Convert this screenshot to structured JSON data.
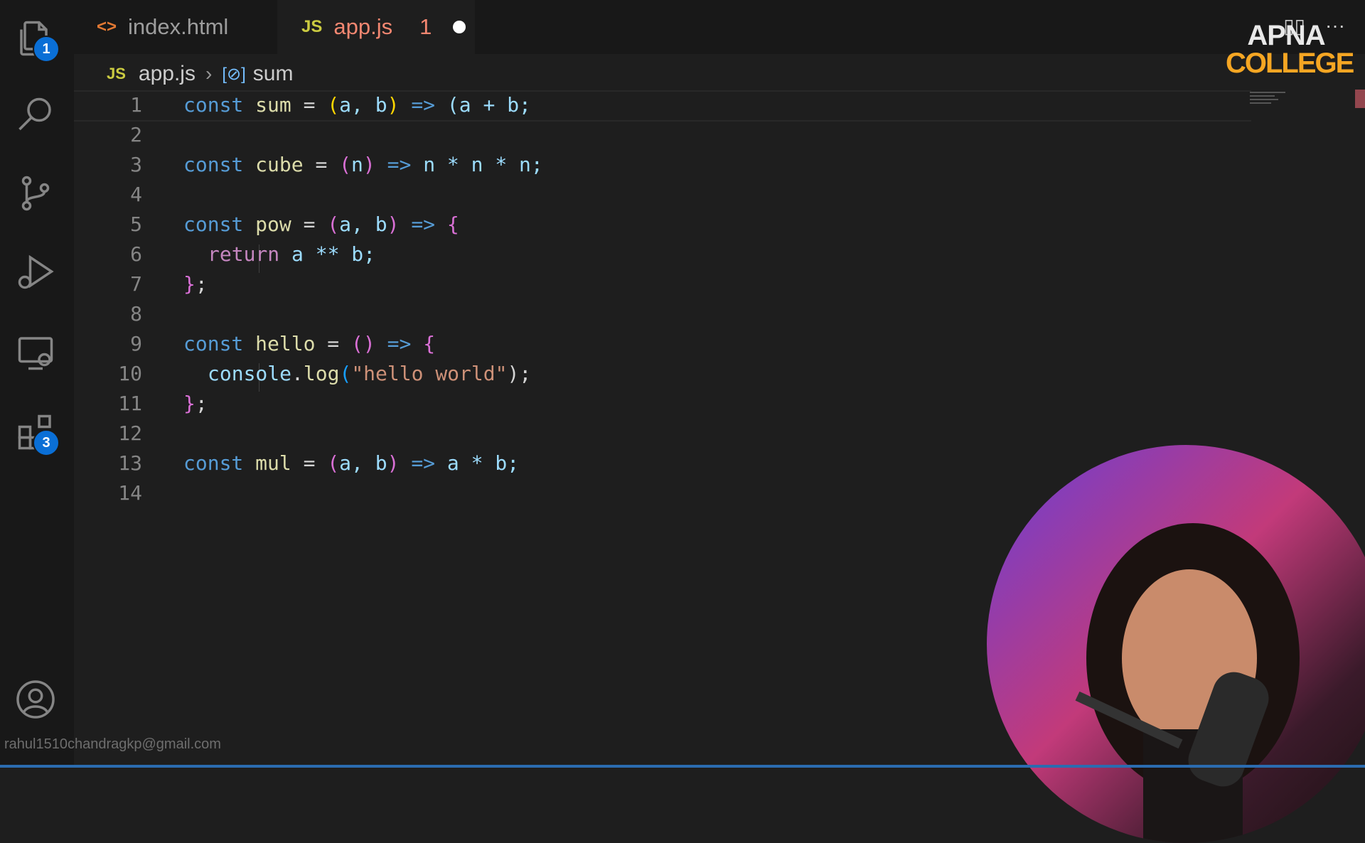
{
  "tabs": [
    {
      "label": "index.html",
      "icon": "html-file-icon",
      "color": "#cccccc"
    },
    {
      "label": "app.js",
      "icon": "js-file-icon",
      "color": "#f48771",
      "problems": "1",
      "modified": true
    }
  ],
  "breadcrumb": {
    "file_type": "JS",
    "file": "app.js",
    "symbol": "sum"
  },
  "activity_bar": {
    "explorer_badge": "1",
    "extensions_badge": "3"
  },
  "editor": {
    "line_numbers": [
      "1",
      "2",
      "3",
      "4",
      "5",
      "6",
      "7",
      "8",
      "9",
      "10",
      "11",
      "12",
      "13",
      "14"
    ],
    "code": {
      "l1": {
        "kw": "const",
        "name": "sum",
        "eq": " = ",
        "params": "a, b",
        "arrow": "=>",
        "body": "(a + b;"
      },
      "l3": {
        "kw": "const",
        "name": "cube",
        "eq": " = ",
        "params": "n",
        "arrow": "=>",
        "body": "n * n * n;"
      },
      "l5": {
        "kw": "const",
        "name": "pow",
        "eq": " = ",
        "params": "a, b",
        "arrow": "=>",
        "open": "{"
      },
      "l6": {
        "ret": "return",
        "body": "a ** b;"
      },
      "l7": {
        "close": "}",
        "semi": ";"
      },
      "l9": {
        "kw": "const",
        "name": "hello",
        "eq": " = ",
        "params": "",
        "arrow": "=>",
        "open": "{"
      },
      "l10": {
        "obj": "console",
        "method": "log",
        "str": "\"hello world\"",
        "end": ");"
      },
      "l11": {
        "close": "}",
        "semi": ";"
      },
      "l13": {
        "kw": "const",
        "name": "mul",
        "eq": " = ",
        "params": "a, b",
        "arrow": "=>",
        "body": "a * b;"
      }
    }
  },
  "branding": {
    "line1": "APNA",
    "line2": "COLLEGE"
  },
  "footer_email": "rahul1510chandragkp@gmail.com",
  "colors": {
    "accent": "#0a6fd6",
    "modified_tab": "#f48771",
    "brand": "#f5a623"
  }
}
